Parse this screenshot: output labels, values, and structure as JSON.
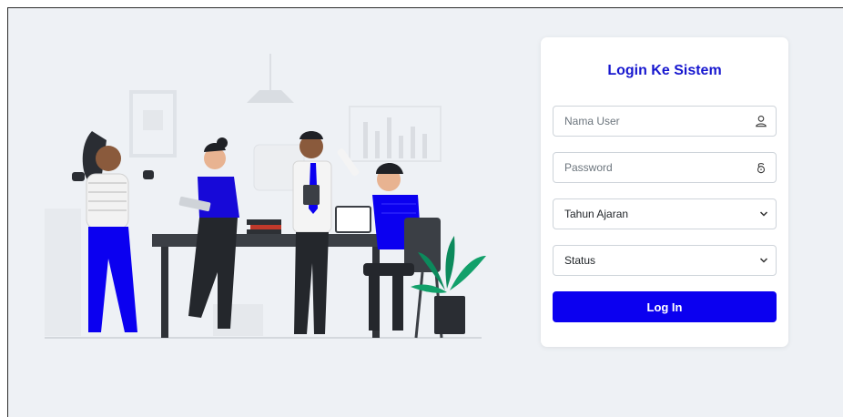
{
  "login": {
    "title": "Login Ke Sistem",
    "username_placeholder": "Nama User",
    "password_placeholder": "Password",
    "tahun_ajaran": "Tahun Ajaran",
    "status": "Status",
    "submit_label": "Log In"
  },
  "icons": {
    "username": "user-icon",
    "password": "lock-icon",
    "dropdown": "chevron-down-icon"
  },
  "colors": {
    "accent": "#0b00f0",
    "title": "#1717cf",
    "background": "#eef1f5"
  }
}
